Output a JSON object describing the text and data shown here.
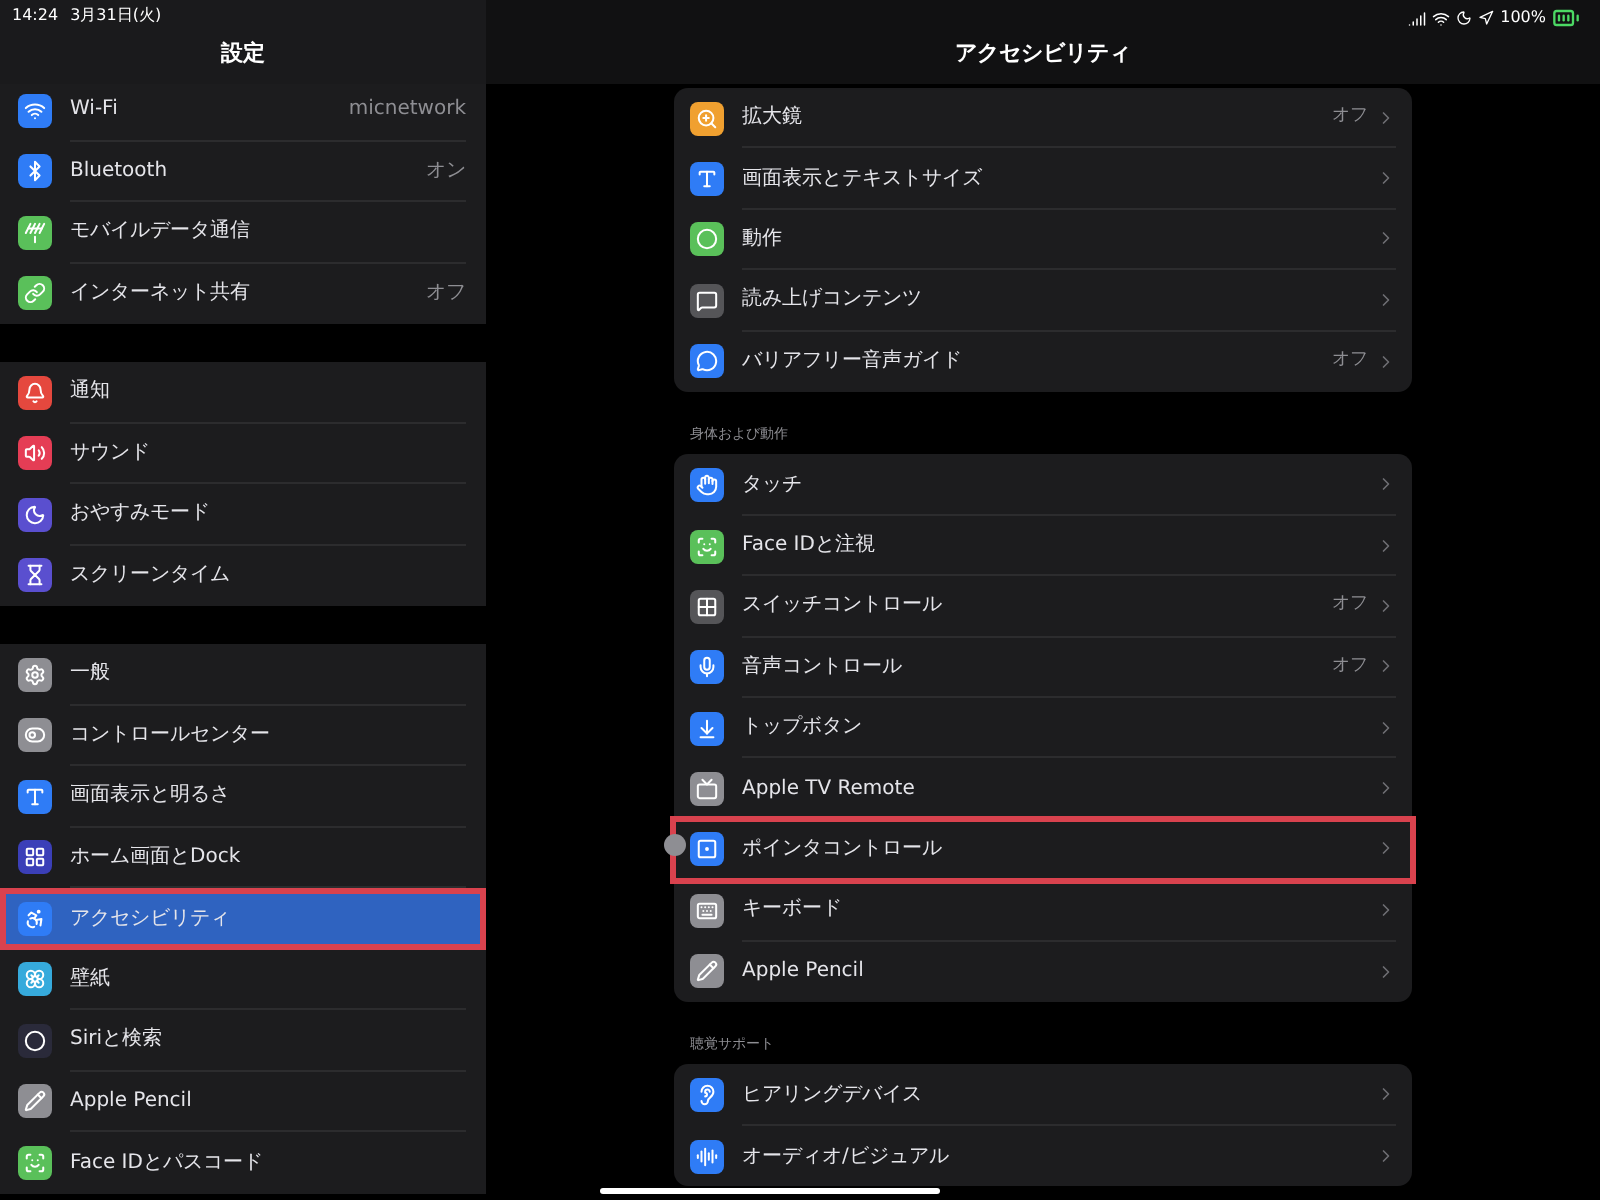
{
  "status_bar": {
    "time": "14:24",
    "date": "3月31日(火)",
    "battery": "100%"
  },
  "sidebar": {
    "title": "設定",
    "groups": [
      [
        {
          "label": "Wi-Fi",
          "value": "micnetwork",
          "color": "#2f7cf6",
          "selected": false,
          "highlighted": false
        },
        {
          "label": "Bluetooth",
          "value": "オン",
          "color": "#2f7cf6",
          "selected": false,
          "highlighted": false
        },
        {
          "label": "モバイルデータ通信",
          "color": "#5ac05a",
          "selected": false,
          "highlighted": false
        },
        {
          "label": "インターネット共有",
          "value": "オフ",
          "color": "#5ac05a",
          "selected": false,
          "highlighted": false
        }
      ],
      [
        {
          "label": "通知",
          "color": "#e5483e",
          "selected": false,
          "highlighted": false
        },
        {
          "label": "サウンド",
          "color": "#e53d55",
          "selected": false,
          "highlighted": false
        },
        {
          "label": "おやすみモード",
          "color": "#5a4fcf",
          "selected": false,
          "highlighted": false
        },
        {
          "label": "スクリーンタイム",
          "color": "#5a4fcf",
          "selected": false,
          "highlighted": false
        }
      ],
      [
        {
          "label": "一般",
          "color": "#8e8e93",
          "selected": false,
          "highlighted": false
        },
        {
          "label": "コントロールセンター",
          "color": "#8e8e93",
          "selected": false,
          "highlighted": false
        },
        {
          "label": "画面表示と明るさ",
          "color": "#2f7cf6",
          "selected": false,
          "highlighted": false
        },
        {
          "label": "ホーム画面とDock",
          "color": "#3b3fb8",
          "selected": false,
          "highlighted": false
        },
        {
          "label": "アクセシビリティ",
          "color": "#2f7cf6",
          "selected": true,
          "highlighted": true
        },
        {
          "label": "壁紙",
          "color": "#36aadc",
          "selected": false,
          "highlighted": false
        },
        {
          "label": "Siriと検索",
          "color": "#2a2a3a",
          "selected": false,
          "highlighted": false
        },
        {
          "label": "Apple Pencil",
          "color": "#8e8e93",
          "selected": false,
          "highlighted": false
        },
        {
          "label": "Face IDとパスコード",
          "color": "#5ac05a",
          "selected": false,
          "highlighted": false
        }
      ]
    ]
  },
  "detail": {
    "title": "アクセシビリティ",
    "sections": [
      {
        "items": [
          {
            "label": "拡大鏡",
            "value": "オフ",
            "color": "#f0a030",
            "highlighted": false
          },
          {
            "label": "画面表示とテキストサイズ",
            "color": "#2f7cf6",
            "highlighted": false
          },
          {
            "label": "動作",
            "color": "#5ac05a",
            "highlighted": false
          },
          {
            "label": "読み上げコンテンツ",
            "color": "#555558",
            "highlighted": false
          },
          {
            "label": "バリアフリー音声ガイド",
            "value": "オフ",
            "color": "#2f7cf6",
            "highlighted": false
          }
        ]
      },
      {
        "header": "身体および動作",
        "items": [
          {
            "label": "タッチ",
            "color": "#2f7cf6",
            "highlighted": false
          },
          {
            "label": "Face IDと注視",
            "color": "#5ac05a",
            "highlighted": false
          },
          {
            "label": "スイッチコントロール",
            "value": "オフ",
            "color": "#555558",
            "highlighted": false
          },
          {
            "label": "音声コントロール",
            "value": "オフ",
            "color": "#2f7cf6",
            "highlighted": false
          },
          {
            "label": "トップボタン",
            "color": "#2f7cf6",
            "highlighted": false
          },
          {
            "label": "Apple TV Remote",
            "color": "#8e8e93",
            "highlighted": false
          },
          {
            "label": "ポインタコントロール",
            "color": "#2f7cf6",
            "highlighted": true
          },
          {
            "label": "キーボード",
            "color": "#8e8e93",
            "highlighted": false
          },
          {
            "label": "Apple Pencil",
            "color": "#8e8e93",
            "highlighted": false
          }
        ]
      },
      {
        "header": "聴覚サポート",
        "items": [
          {
            "label": "ヒアリングデバイス",
            "color": "#2f7cf6",
            "highlighted": false
          },
          {
            "label": "オーディオ/ビジュアル",
            "color": "#2f7cf6",
            "highlighted": false
          }
        ]
      }
    ]
  }
}
